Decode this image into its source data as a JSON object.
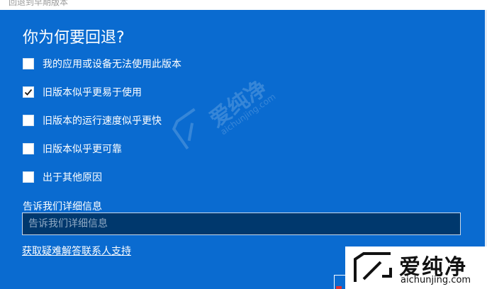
{
  "window": {
    "title": "回退到早期版本"
  },
  "dialog": {
    "heading": "你为何要回退?",
    "options": [
      {
        "label": "我的应用或设备无法使用此版本",
        "checked": false
      },
      {
        "label": "旧版本似乎更易于使用",
        "checked": true
      },
      {
        "label": "旧版本的运行速度似乎更快",
        "checked": false
      },
      {
        "label": "旧版本似乎更可靠",
        "checked": false
      },
      {
        "label": "出于其他原因",
        "checked": false
      }
    ],
    "details": {
      "label": "告诉我们详细信息",
      "placeholder": "告诉我们详细信息",
      "value": ""
    },
    "help_link": "获取疑难解答联系人支持"
  },
  "watermark": {
    "text": "爱纯净",
    "domain": "aichunjing.com"
  },
  "colors": {
    "panel_background": "#0a6bd0",
    "input_background": "#00386d",
    "text": "#ffffff",
    "check_mark": "#1a1a1a"
  },
  "icons": {
    "checkmark": "checkmark-icon",
    "logo": "aichunjing-logo-icon"
  }
}
